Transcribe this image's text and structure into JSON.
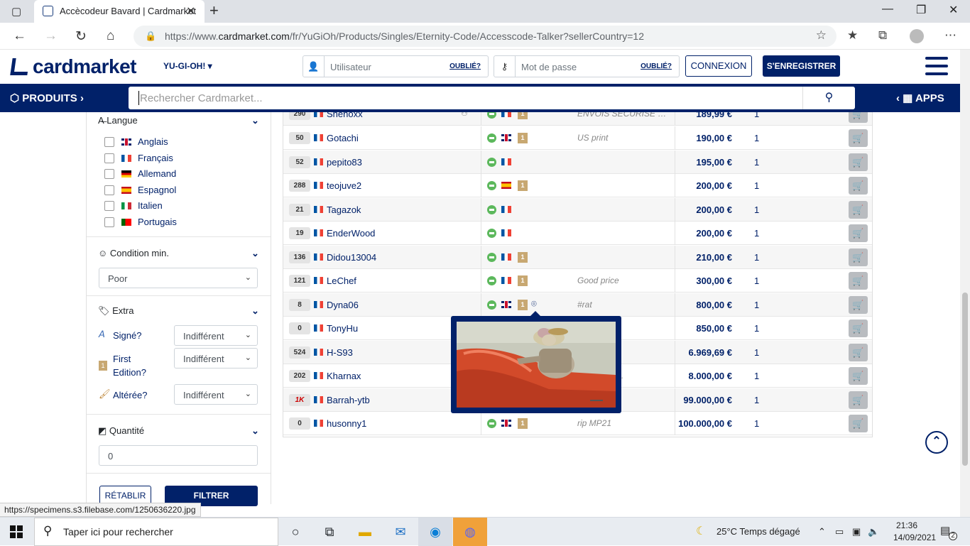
{
  "browser": {
    "tab_title": "Accècodeur Bavard | Cardmarket",
    "url_prefix": "https://www.",
    "url_domain": "cardmarket.com",
    "url_path": "/fr/YuGiOh/Products/Singles/Eternity-Code/Accesscode-Talker?sellerCountry=12",
    "status_url": "https://specimens.s3.filebase.com/1250636220.jpg"
  },
  "header": {
    "logo": "cardmarket",
    "game": "YU-GI-OH!",
    "user_placeholder": "Utilisateur",
    "forgot_user": "OUBLIÉ?",
    "pass_placeholder": "Mot de passe",
    "forgot_pass": "OUBLIÉ?",
    "connect": "CONNEXION",
    "register": "S'ENREGISTRER"
  },
  "navbar": {
    "products": "PRODUITS",
    "search_placeholder": "Rechercher Cardmarket...",
    "apps": "APPS"
  },
  "sidebar": {
    "language_title": "Langue",
    "languages": [
      {
        "label": "Anglais",
        "flag": "gb"
      },
      {
        "label": "Français",
        "flag": "fr"
      },
      {
        "label": "Allemand",
        "flag": "de"
      },
      {
        "label": "Espagnol",
        "flag": "es"
      },
      {
        "label": "Italien",
        "flag": "it"
      },
      {
        "label": "Portugais",
        "flag": "pt"
      }
    ],
    "condition_title": "Condition min.",
    "condition_value": "Poor",
    "extra_title": "Extra",
    "signed_label": "Signé?",
    "signed_value": "Indifférent",
    "first_label": "First Edition?",
    "first_value": "Indifférent",
    "altered_label": "Altérée?",
    "altered_value": "Indifférent",
    "quantity_title": "Quantité",
    "quantity_value": "0",
    "reset": "RÉTABLIR",
    "filter": "FILTRER"
  },
  "offers": [
    {
      "sales": "290",
      "seller": "Shenoxx",
      "card_flag": "fr",
      "first": true,
      "comment": "ENVOIS SÉCURISÉ et ...",
      "price": "189,99 €",
      "qty": "1"
    },
    {
      "sales": "50",
      "seller": "Gotachi",
      "card_flag": "gb",
      "first": true,
      "comment": "US print",
      "price": "190,00 €",
      "qty": "1"
    },
    {
      "sales": "52",
      "seller": "pepito83",
      "card_flag": "fr",
      "first": false,
      "comment": "",
      "price": "195,00 €",
      "qty": "1"
    },
    {
      "sales": "288",
      "seller": "teojuve2",
      "card_flag": "es",
      "first": true,
      "comment": "",
      "price": "200,00 €",
      "qty": "1"
    },
    {
      "sales": "21",
      "seller": "Tagazok",
      "card_flag": "fr",
      "first": false,
      "comment": "",
      "price": "200,00 €",
      "qty": "1"
    },
    {
      "sales": "19",
      "seller": "EnderWood",
      "card_flag": "fr",
      "first": false,
      "comment": "",
      "price": "200,00 €",
      "qty": "1"
    },
    {
      "sales": "136",
      "seller": "Didou13004",
      "card_flag": "fr",
      "first": true,
      "comment": "",
      "price": "210,00 €",
      "qty": "1"
    },
    {
      "sales": "121",
      "seller": "LeChef",
      "card_flag": "fr",
      "first": true,
      "comment": "Good price",
      "price": "300,00 €",
      "qty": "1"
    },
    {
      "sales": "8",
      "seller": "Dyna06",
      "card_flag": "gb",
      "first": true,
      "photo": true,
      "comment": "#rat",
      "price": "800,00 €",
      "qty": "1"
    },
    {
      "sales": "0",
      "seller": "TonyHu",
      "card_flag": "",
      "first": false,
      "comment": "ast chippi...",
      "price": "850,00 €",
      "qty": "1"
    },
    {
      "sales": "524",
      "seller": "H-S93",
      "card_flag": "",
      "first": false,
      "comment": "scode go ...",
      "price": "6.969,69 €",
      "qty": "1"
    },
    {
      "sales": "202",
      "seller": "Kharnax",
      "card_flag": "",
      "first": false,
      "comment": "s cher, un ...",
      "price": "8.000,00 €",
      "qty": "1"
    },
    {
      "sales": "1K",
      "seller": "Barrah-ytb",
      "card_flag": "",
      "first": false,
      "comment": "r une villa...",
      "price": "99.000,00 €",
      "qty": "1"
    },
    {
      "sales": "0",
      "seller": "husonny1",
      "card_flag": "gb",
      "first": true,
      "comment": "rip MP21",
      "price": "100.000,00 €",
      "qty": "1"
    }
  ],
  "taskbar": {
    "search": "Taper ici pour rechercher",
    "weather": "25°C  Temps dégagé",
    "time": "21:36",
    "date": "14/09/2021",
    "notif": "2"
  }
}
